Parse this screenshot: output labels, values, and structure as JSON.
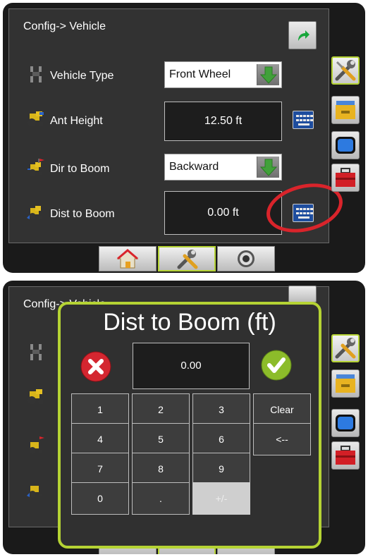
{
  "config": {
    "title": "Config-> Vehicle",
    "rows": [
      {
        "label": "Vehicle Type",
        "value": "Front Wheel"
      },
      {
        "label": "Ant Height",
        "value": "12.50 ft"
      },
      {
        "label": "Dir to Boom",
        "value": "Backward"
      },
      {
        "label": "Dist to Boom",
        "value": "0.00 ft"
      }
    ]
  },
  "popup": {
    "title": "Dist to Boom (ft)",
    "value": "0.00",
    "keys": [
      "1",
      "2",
      "3",
      "Clear",
      "4",
      "5",
      "6",
      "<--",
      "7",
      "8",
      "9",
      "0",
      ".",
      "+/-"
    ]
  },
  "colors": {
    "accent_green": "#b5d334",
    "annotation_red": "#d9242b",
    "keyboard_blue": "#1e4d9e"
  }
}
